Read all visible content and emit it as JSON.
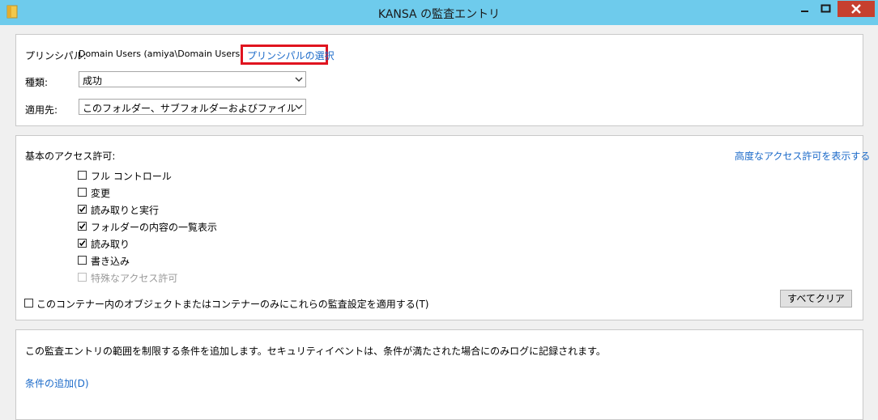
{
  "window": {
    "title": "KANSA の監査エントリ",
    "icon": "folder-icon",
    "buttons": [
      "minimize-icon",
      "maximize-icon",
      "close-icon"
    ]
  },
  "principal": {
    "label": "プリンシパル:",
    "value": "Domain Users (amiya\\Domain Users)",
    "select_link": "プリンシパルの選択"
  },
  "type": {
    "label": "種類:",
    "selected": "成功"
  },
  "applies_to": {
    "label": "適用先:",
    "selected": "このフォルダー、サブフォルダーおよびファイル"
  },
  "permissions": {
    "label": "基本のアクセス許可:",
    "advanced_link": "高度なアクセス許可を表示する",
    "items": [
      {
        "label": "フル コントロール",
        "checked": false,
        "disabled": false
      },
      {
        "label": "変更",
        "checked": false,
        "disabled": false
      },
      {
        "label": "読み取りと実行",
        "checked": true,
        "disabled": false
      },
      {
        "label": "フォルダーの内容の一覧表示",
        "checked": true,
        "disabled": false
      },
      {
        "label": "読み取り",
        "checked": true,
        "disabled": false
      },
      {
        "label": "書き込み",
        "checked": false,
        "disabled": false
      },
      {
        "label": "特殊なアクセス許可",
        "checked": false,
        "disabled": true
      }
    ],
    "apply_only_label": "このコンテナー内のオブジェクトまたはコンテナーのみにこれらの監査設定を適用する(T)",
    "apply_only_checked": false,
    "clear_all_label": "すべてクリア"
  },
  "conditions": {
    "description": "この監査エントリの範囲を制限する条件を追加します。セキュリティイベントは、条件が満たされた場合にのみログに記録されます。",
    "add_link": "条件の追加(D)"
  },
  "colors": {
    "titlebar": "#6ecbec",
    "link": "#1b6ac9",
    "highlight": "#e0141f",
    "close_button": "#c6402f"
  }
}
